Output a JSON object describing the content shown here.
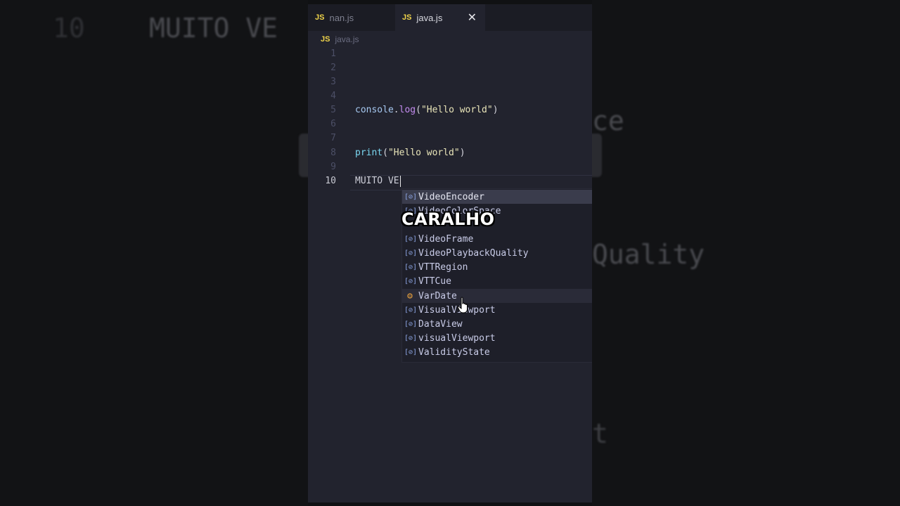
{
  "background": {
    "line_number": "10",
    "code_fragment": "MUITO VE",
    "right_fragment_1": "ce",
    "right_fragment_2": "Quality",
    "right_fragment_3": "t"
  },
  "tabs": [
    {
      "label": "nan.js",
      "icon": "JS"
    },
    {
      "label": "java.js",
      "icon": "JS",
      "active": true
    }
  ],
  "breadcrumb": {
    "icon": "JS",
    "file": "java.js"
  },
  "editor": {
    "lines": [
      {
        "n": "1",
        "code": ""
      },
      {
        "n": "2",
        "code": ""
      },
      {
        "n": "3",
        "code": ""
      },
      {
        "n": "4",
        "code": ""
      },
      {
        "n": "5",
        "object": "console",
        "dot": ".",
        "method": "log",
        "open": "(",
        "string": "\"Hello world\"",
        "close": ")"
      },
      {
        "n": "6",
        "code": ""
      },
      {
        "n": "7",
        "code": ""
      },
      {
        "n": "8",
        "method": "print",
        "open": "(",
        "string": "\"Hello world\"",
        "close": ")"
      },
      {
        "n": "9",
        "code": ""
      },
      {
        "n": "10",
        "code": "MUITO VE"
      }
    ]
  },
  "suggestions": [
    {
      "label": "VideoEncoder",
      "icon": "variable-icon"
    },
    {
      "label": "VideoColorSpace",
      "icon": "variable-icon"
    },
    {
      "label": "VideoFrame",
      "icon": "variable-icon"
    },
    {
      "label": "VideoPlaybackQuality",
      "icon": "variable-icon"
    },
    {
      "label": "VTTRegion",
      "icon": "variable-icon"
    },
    {
      "label": "VTTCue",
      "icon": "variable-icon"
    },
    {
      "label": "VarDate",
      "icon": "class-icon"
    },
    {
      "label": "VisualViewport",
      "icon": "variable-icon"
    },
    {
      "label": "DataView",
      "icon": "variable-icon"
    },
    {
      "label": "visualViewport",
      "icon": "variable-icon"
    },
    {
      "label": "ValidityState",
      "icon": "variable-icon"
    }
  ],
  "caption": "CARALHO",
  "colors": {
    "accent_js": "#f0d44a",
    "editor_bg": "#22232e",
    "class_icon": "#e8a03c"
  }
}
